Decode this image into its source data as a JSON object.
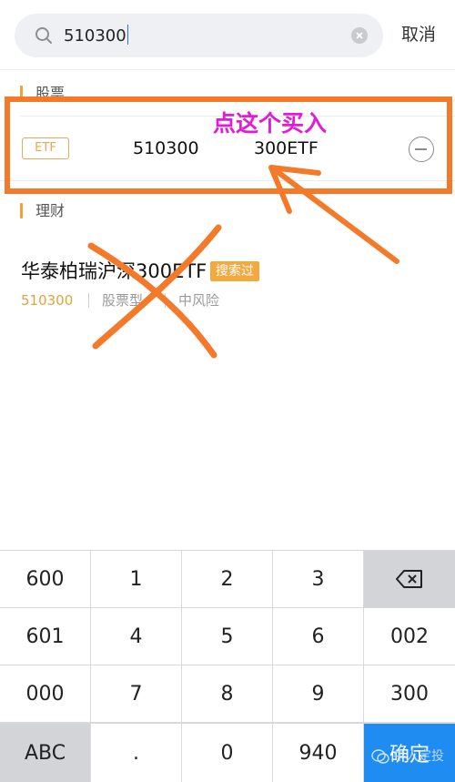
{
  "search": {
    "value": "510300",
    "cancel_label": "取消"
  },
  "sections": {
    "stocks_label": "股票",
    "finance_label": "理财"
  },
  "stock_result": {
    "tag": "ETF",
    "code": "510300",
    "name": "300ETF"
  },
  "fund_result": {
    "title": "华泰柏瑞沪深300ETF",
    "badge": "搜索过",
    "code": "510300",
    "type": "股票型",
    "risk": "中风险"
  },
  "annotation": {
    "text": "点这个买入",
    "highlight_color": "#f47a2a",
    "text_color": "#e21bd6"
  },
  "keypad": {
    "rows": [
      [
        "600",
        "1",
        "2",
        "3",
        "⌫"
      ],
      [
        "601",
        "4",
        "5",
        "6",
        "002"
      ],
      [
        "000",
        "7",
        "8",
        "9",
        "300"
      ],
      [
        "ABC",
        ".",
        "0",
        "940",
        "确定"
      ]
    ]
  },
  "watermark": "牛人定投",
  "colors": {
    "accent_orange": "#f0a23a",
    "confirm_blue": "#1e8cf0"
  }
}
